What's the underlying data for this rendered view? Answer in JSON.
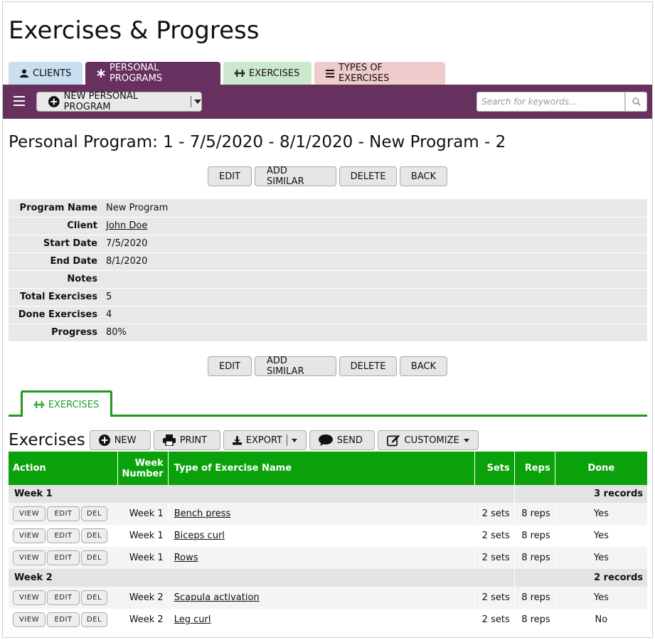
{
  "app": {
    "title": "Exercises & Progress"
  },
  "tabs": [
    {
      "label": "CLIENTS",
      "icon": "user-icon"
    },
    {
      "label": "PERSONAL PROGRAMS",
      "icon": "asterisk-icon"
    },
    {
      "label": "EXERCISES",
      "icon": "dumbbell-icon"
    },
    {
      "label": "TYPES OF EXERCISES",
      "icon": "list-icon"
    }
  ],
  "toolbar": {
    "new_label": "NEW PERSONAL PROGRAM",
    "search_placeholder": "Search for keywords..."
  },
  "record": {
    "title": "Personal Program: 1 - 7/5/2020 - 8/1/2020 - New Program - 2",
    "buttons": {
      "edit": "EDIT",
      "add_similar": "ADD SIMILAR",
      "delete": "DELETE",
      "back": "BACK"
    },
    "fields": {
      "program_name": {
        "label": "Program Name",
        "value": "New Program"
      },
      "client": {
        "label": "Client",
        "value": "John Doe"
      },
      "start_date": {
        "label": "Start Date",
        "value": "7/5/2020"
      },
      "end_date": {
        "label": "End Date",
        "value": "8/1/2020"
      },
      "notes": {
        "label": "Notes",
        "value": ""
      },
      "total_exercises": {
        "label": "Total Exercises",
        "value": "5"
      },
      "done_exercises": {
        "label": "Done Exercises",
        "value": "4"
      },
      "progress": {
        "label": "Progress",
        "value": "80%"
      }
    }
  },
  "subtab": {
    "label": "EXERCISES"
  },
  "exercises": {
    "title": "Exercises",
    "buttons": {
      "new": "NEW",
      "print": "PRINT",
      "export": "EXPORT",
      "send": "SEND",
      "customize": "CUSTOMIZE"
    },
    "columns": {
      "action": "Action",
      "week": "Week Number",
      "type": "Type of Exercise Name",
      "sets": "Sets",
      "reps": "Reps",
      "done": "Done"
    },
    "row_buttons": {
      "view": "VIEW",
      "edit": "EDIT",
      "del": "DEL"
    },
    "groups": [
      {
        "label": "Week 1",
        "count": "3 records",
        "rows": [
          {
            "week": "Week 1",
            "type": "Bench press",
            "sets": "2 sets",
            "reps": "8 reps",
            "done": "Yes"
          },
          {
            "week": "Week 1",
            "type": "Biceps curl",
            "sets": "2 sets",
            "reps": "8 reps",
            "done": "Yes"
          },
          {
            "week": "Week 1",
            "type": "Rows",
            "sets": "2 sets",
            "reps": "8 reps",
            "done": "Yes"
          }
        ]
      },
      {
        "label": "Week 2",
        "count": "2 records",
        "rows": [
          {
            "week": "Week 2",
            "type": "Scapula activation",
            "sets": "2 sets",
            "reps": "8 reps",
            "done": "Yes"
          },
          {
            "week": "Week 2",
            "type": "Leg curl",
            "sets": "2 sets",
            "reps": "8 reps",
            "done": "No"
          }
        ]
      }
    ]
  },
  "colors": {
    "primary": "#66305f",
    "accent": "#0aa10a",
    "tab_clients": "#c9deef",
    "tab_exercises": "#cce8cc",
    "tab_types": "#efcccc"
  }
}
